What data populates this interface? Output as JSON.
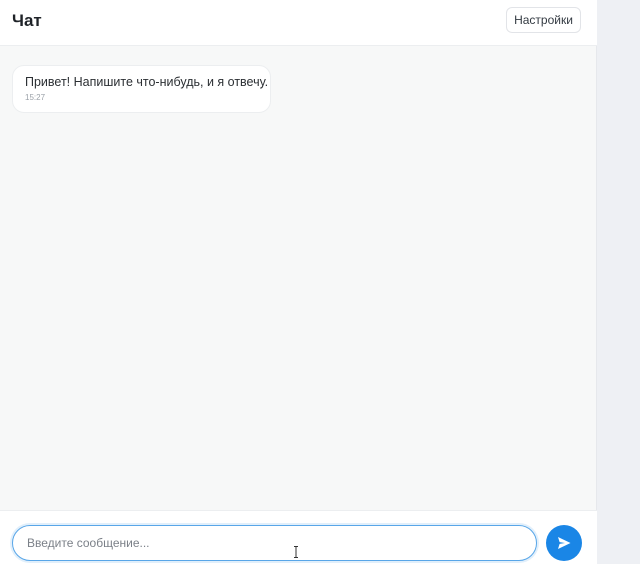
{
  "header": {
    "title": "Чат",
    "settings_label": "Настройки"
  },
  "messages": [
    {
      "text": "Привет! Напишите что-нибудь, и я отвечу.",
      "time": "15:27",
      "sender": "bot"
    }
  ],
  "composer": {
    "placeholder": "Введите сообщение...",
    "value": "",
    "send_icon": "send-icon"
  },
  "colors": {
    "accent": "#1a86e6",
    "input_focus_border": "#58a6e8",
    "background": "#f7f8f8"
  }
}
